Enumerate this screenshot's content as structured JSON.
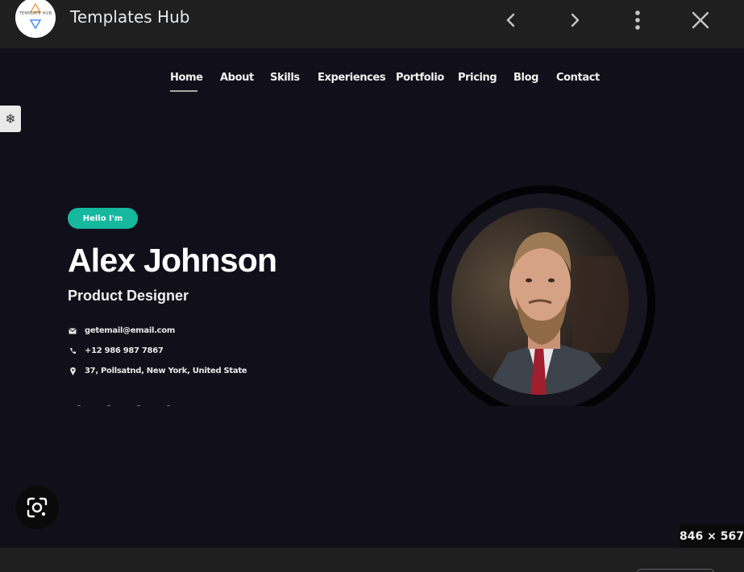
{
  "viewer": {
    "site_title": "Templates Hub",
    "logo_text": "TEMPLATE HUB",
    "icons": {
      "prev": "chevron-left-icon",
      "next": "chevron-right-icon",
      "more": "more-vertical-icon",
      "close": "close-icon",
      "lens": "google-lens-icon"
    },
    "image_dimensions": "846 × 567"
  },
  "site": {
    "nav": [
      "Home",
      "About",
      "Skills",
      "Experiences",
      "Portfolio",
      "Pricing",
      "Blog",
      "Contact"
    ],
    "active_nav": "Home",
    "hero": {
      "greeting": "Hello I'm",
      "name": "Alex Johnson",
      "role": "Product Designer",
      "contacts": [
        {
          "icon": "envelope-icon",
          "text": "getemail@email.com"
        },
        {
          "icon": "phone-icon",
          "text": "+12 986 987 7867"
        },
        {
          "icon": "map-pin-icon",
          "text": "37, Pollsatnd, New York, United State"
        }
      ]
    }
  },
  "colors": {
    "accent": "#16b89e",
    "page_bg": "#11101a",
    "viewer_bg": "#1f1f1f"
  }
}
